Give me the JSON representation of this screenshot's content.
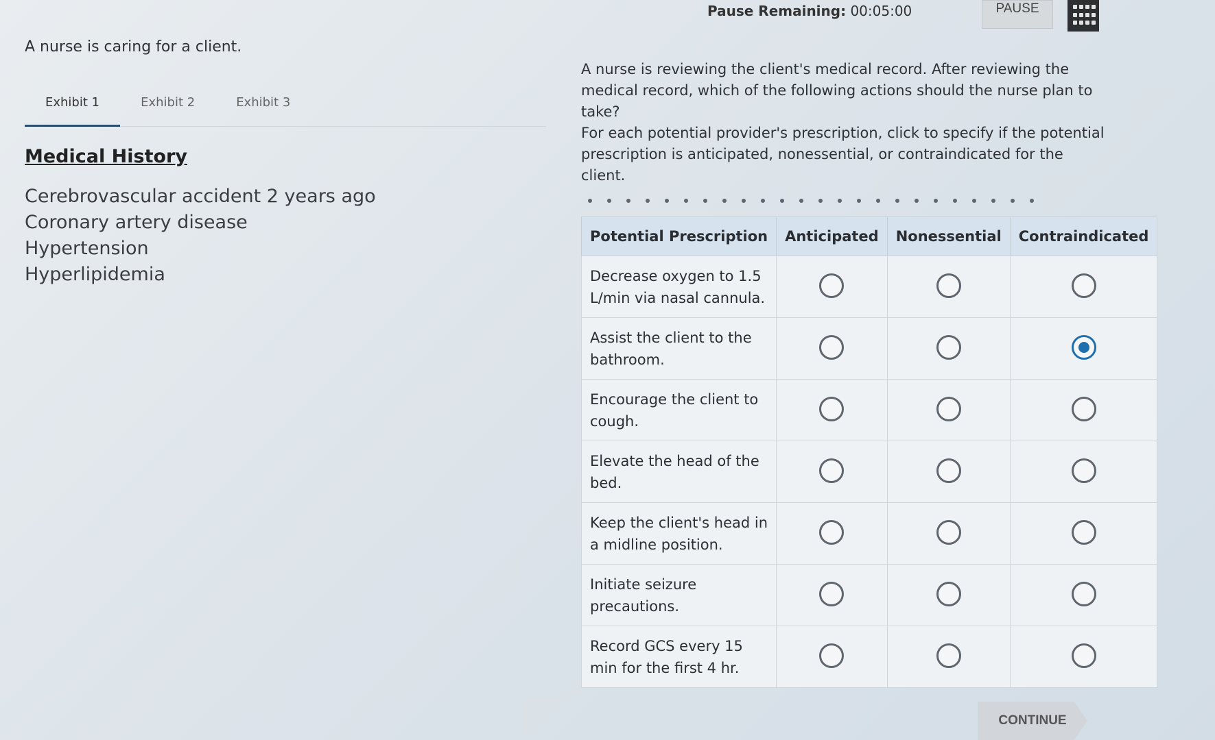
{
  "header": {
    "pause_remaining_label": "Pause Remaining:",
    "pause_remaining_value": "00:05:00",
    "pause_button": "PAUSE",
    "calculator_icon": "calculator-icon"
  },
  "left": {
    "stem": "A nurse is caring for a client.",
    "tabs": [
      "Exhibit 1",
      "Exhibit 2",
      "Exhibit 3"
    ],
    "active_tab": "Exhibit 1",
    "section_title": "Medical History",
    "history": [
      "Cerebrovascular accident 2 years ago",
      "Coronary artery disease",
      "Hypertension",
      "Hyperlipidemia"
    ]
  },
  "right": {
    "prompt_1": "A nurse is reviewing the client's medical record. After reviewing the medical record, which of the following actions should the nurse plan to take?",
    "prompt_2": "For each potential provider's prescription, click to specify if the potential prescription is anticipated, nonessential, or contraindicated for the client.",
    "table": {
      "headers": [
        "Potential Prescription",
        "Anticipated",
        "Nonessential",
        "Contraindicated"
      ],
      "rows": [
        {
          "text": "Decrease oxygen to 1.5 L/min via nasal cannula.",
          "selected": null
        },
        {
          "text": "Assist the client to the bathroom.",
          "selected": "Contraindicated"
        },
        {
          "text": "Encourage the client to cough.",
          "selected": null
        },
        {
          "text": "Elevate the head of the bed.",
          "selected": null
        },
        {
          "text": "Keep the client's head in a midline position.",
          "selected": null
        },
        {
          "text": "Initiate seizure precautions.",
          "selected": null
        },
        {
          "text": "Record GCS every 15 min for the first 4 hr.",
          "selected": null
        }
      ]
    }
  },
  "footer": {
    "continue_button": "CONTINUE"
  },
  "colors": {
    "accent": "#1f6fae",
    "header_bg": "#d6e3ee",
    "tab_underline": "#2b4e6f"
  }
}
